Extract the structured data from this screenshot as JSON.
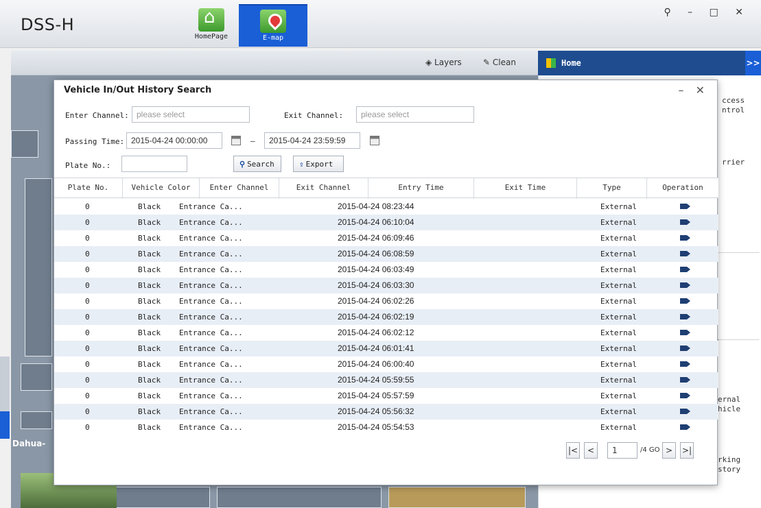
{
  "app": {
    "title": "DSS-H",
    "window_controls": "⚲ – □ ✕"
  },
  "topnav": [
    {
      "label": "HomePage",
      "icon": "home-icon"
    },
    {
      "label": "E-map",
      "icon": "map-pin-icon"
    }
  ],
  "toolbar": {
    "layers": "Layers",
    "clean": "Clean",
    "home": "Home",
    "expand": ">>"
  },
  "right_panel": {
    "items": [
      "ccess",
      "ntrol",
      "rrier",
      "ernal",
      "hicle",
      "rking",
      "story"
    ]
  },
  "dialog": {
    "title": "Vehicle In/Out History Search",
    "controls": "– ✕",
    "enter_channel_label": "Enter Channel:",
    "enter_channel_placeholder": "please select",
    "exit_channel_label": "Exit Channel:",
    "exit_channel_placeholder": "please select",
    "passing_time_label": "Passing Time:",
    "time_start": "2015-04-24 00:00:00",
    "time_sep": "–",
    "time_end": "2015-04-24 23:59:59",
    "plate_label": "Plate No.:",
    "plate_value": "",
    "search_label": "Search",
    "export_label": "Export"
  },
  "table": {
    "columns": [
      "Plate No.",
      "Vehicle Color",
      "Enter Channel",
      "Exit Channel",
      "Entry Time",
      "Exit Time",
      "Type",
      "Operation"
    ],
    "rows": [
      {
        "plate": "0",
        "color": "Black",
        "enter": "Entrance Ca...",
        "exit": "",
        "entry_time": "2015-04-24 08:23:44",
        "exit_time": "",
        "type": "External"
      },
      {
        "plate": "0",
        "color": "Black",
        "enter": "Entrance Ca...",
        "exit": "",
        "entry_time": "2015-04-24 06:10:04",
        "exit_time": "",
        "type": "External"
      },
      {
        "plate": "0",
        "color": "Black",
        "enter": "Entrance Ca...",
        "exit": "",
        "entry_time": "2015-04-24 06:09:46",
        "exit_time": "",
        "type": "External"
      },
      {
        "plate": "0",
        "color": "Black",
        "enter": "Entrance Ca...",
        "exit": "",
        "entry_time": "2015-04-24 06:08:59",
        "exit_time": "",
        "type": "External"
      },
      {
        "plate": "0",
        "color": "Black",
        "enter": "Entrance Ca...",
        "exit": "",
        "entry_time": "2015-04-24 06:03:49",
        "exit_time": "",
        "type": "External"
      },
      {
        "plate": "0",
        "color": "Black",
        "enter": "Entrance Ca...",
        "exit": "",
        "entry_time": "2015-04-24 06:03:30",
        "exit_time": "",
        "type": "External"
      },
      {
        "plate": "0",
        "color": "Black",
        "enter": "Entrance Ca...",
        "exit": "",
        "entry_time": "2015-04-24 06:02:26",
        "exit_time": "",
        "type": "External"
      },
      {
        "plate": "0",
        "color": "Black",
        "enter": "Entrance Ca...",
        "exit": "",
        "entry_time": "2015-04-24 06:02:19",
        "exit_time": "",
        "type": "External"
      },
      {
        "plate": "0",
        "color": "Black",
        "enter": "Entrance Ca...",
        "exit": "",
        "entry_time": "2015-04-24 06:02:12",
        "exit_time": "",
        "type": "External"
      },
      {
        "plate": "0",
        "color": "Black",
        "enter": "Entrance Ca...",
        "exit": "",
        "entry_time": "2015-04-24 06:01:41",
        "exit_time": "",
        "type": "External"
      },
      {
        "plate": "0",
        "color": "Black",
        "enter": "Entrance Ca...",
        "exit": "",
        "entry_time": "2015-04-24 06:00:40",
        "exit_time": "",
        "type": "External"
      },
      {
        "plate": "0",
        "color": "Black",
        "enter": "Entrance Ca...",
        "exit": "",
        "entry_time": "2015-04-24 05:59:55",
        "exit_time": "",
        "type": "External"
      },
      {
        "plate": "0",
        "color": "Black",
        "enter": "Entrance Ca...",
        "exit": "",
        "entry_time": "2015-04-24 05:57:59",
        "exit_time": "",
        "type": "External"
      },
      {
        "plate": "0",
        "color": "Black",
        "enter": "Entrance Ca...",
        "exit": "",
        "entry_time": "2015-04-24 05:56:32",
        "exit_time": "",
        "type": "External"
      },
      {
        "plate": "0",
        "color": "Black",
        "enter": "Entrance Ca...",
        "exit": "",
        "entry_time": "2015-04-24 05:54:53",
        "exit_time": "",
        "type": "External"
      }
    ],
    "operation_icon": "video-camera-icon"
  },
  "pager": {
    "first": "|<",
    "prev": "<",
    "page": "1",
    "total": "/4 GO",
    "next": ">",
    "last": ">|"
  },
  "map": {
    "label": "Dahua-"
  }
}
